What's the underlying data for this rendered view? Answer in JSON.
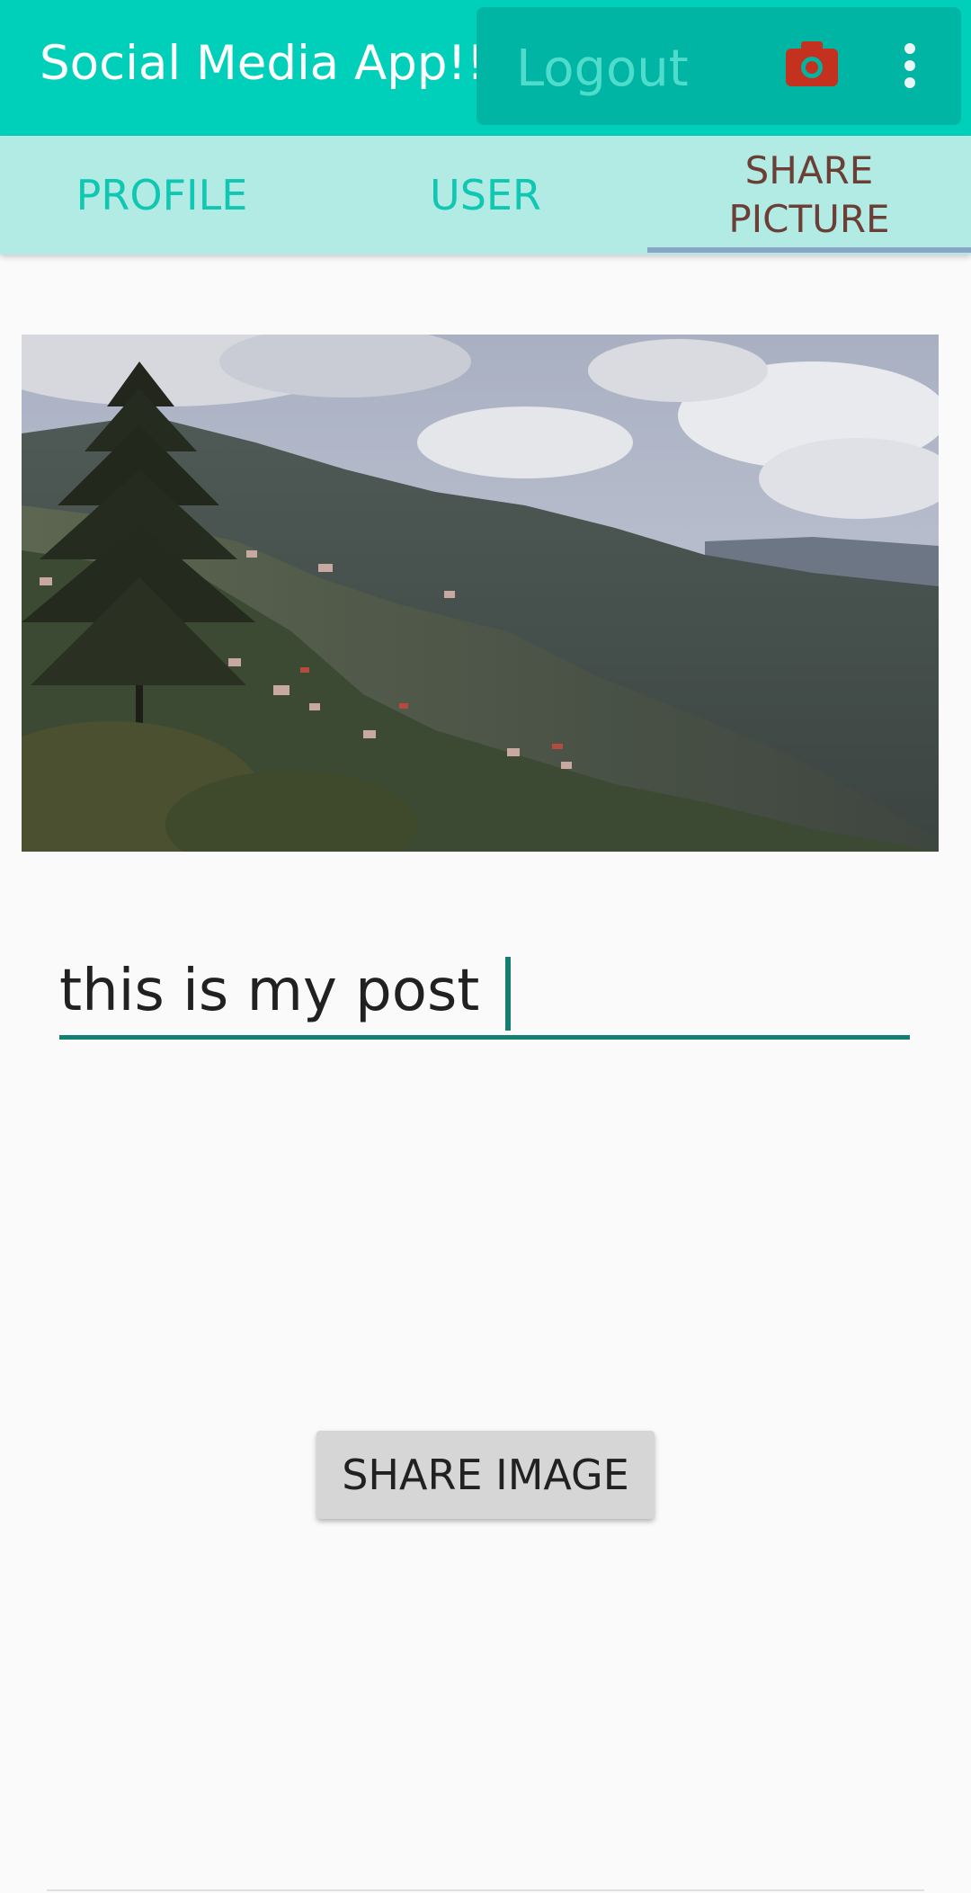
{
  "appbar": {
    "title": "Social Media App!!!",
    "logout_label": "Logout",
    "camera_icon": "camera-icon",
    "overflow_icon": "more-vert-icon",
    "colors": {
      "background": "#00d0b9",
      "action_box": "#00b5a3",
      "camera": "#c4321f"
    }
  },
  "tabs": [
    {
      "label": "PROFILE",
      "selected": false
    },
    {
      "label": "USER",
      "selected": false
    },
    {
      "label": "SHARE PICTURE",
      "selected": true
    }
  ],
  "post_input": {
    "value": "this is my post "
  },
  "share_button": {
    "label": "SHARE IMAGE"
  }
}
